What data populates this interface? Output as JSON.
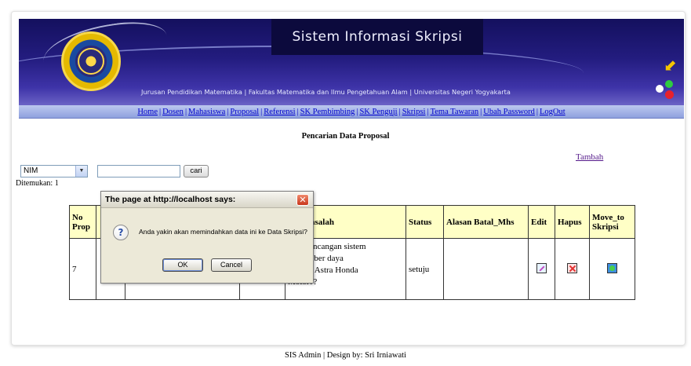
{
  "header": {
    "title": "Sistem Informasi Skripsi",
    "subtitle": "Jurusan Pendidikan Matematika | Fakultas Matematika dan Ilmu Pengetahuan Alam | Universitas Negeri Yogyakarta"
  },
  "nav": {
    "items": [
      "Home",
      "Dosen",
      "Mahasiswa",
      "Proposal",
      "Referensi",
      "SK Pembimbing",
      "SK Penguji",
      "Skripsi",
      "Tema Tawaran",
      "Ubah Password",
      "LogOut"
    ],
    "separator": "|"
  },
  "page": {
    "heading": "Pencarian Data Proposal",
    "add_link": "Tambah",
    "found_label": "Ditemukan: 1"
  },
  "search": {
    "field_selected": "NIM",
    "query_value": "",
    "button_label": "cari"
  },
  "table": {
    "headers": {
      "no_prop": "No Prop",
      "rumusan": "san Masalah",
      "status": "Status",
      "alasan": "Alasan Batal_Mhs",
      "edit": "Edit",
      "hapus": "Hapus",
      "move": "Move_to Skripsi"
    },
    "row": {
      "no_prop": "7",
      "rumusan_line1": "nana rancangan sistem",
      "rumusan_line2": "asi sumber daya",
      "rumusan_line3": "a di PT Astra Honda",
      "rumusan_line4": "Motor??",
      "status": "setuju",
      "alasan": ""
    }
  },
  "dialog": {
    "title": "The page at http://localhost says:",
    "message": "Anda yakin akan memindahkan data ini ke Data Skripsi?",
    "ok_label": "OK",
    "cancel_label": "Cancel",
    "icon": "question-icon"
  },
  "footer": {
    "text": "SIS Admin | Design by: Sri Irniawati"
  },
  "colors": {
    "banner": "#231c7f",
    "navbar": "#a3b2e5",
    "table_header": "#ffffc6"
  }
}
